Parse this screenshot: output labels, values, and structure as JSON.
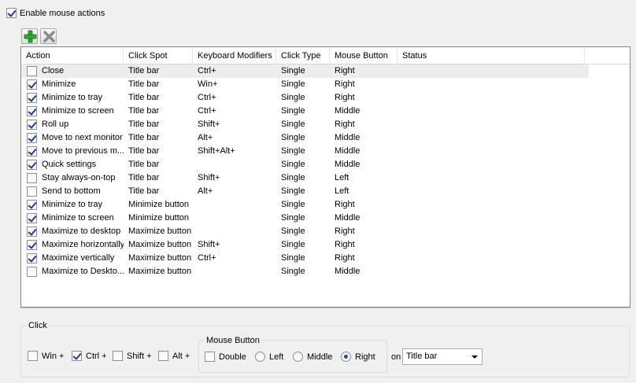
{
  "enable": {
    "label": "Enable mouse actions",
    "checked": true
  },
  "toolbar": {
    "add_icon": "green-plus-icon",
    "remove_icon": "gray-x-icon"
  },
  "grid": {
    "columns": [
      "Action",
      "Click Spot",
      "Keyboard Modifiers",
      "Click Type",
      "Mouse Button",
      "Status"
    ],
    "rows": [
      {
        "checked": false,
        "action": "Close",
        "spot": "Title bar",
        "mods": "Ctrl+",
        "type": "Single",
        "button": "Right",
        "status": "",
        "selected": true
      },
      {
        "checked": true,
        "action": "Minimize",
        "spot": "Title bar",
        "mods": "Win+",
        "type": "Single",
        "button": "Right",
        "status": ""
      },
      {
        "checked": true,
        "action": "Minimize to tray",
        "spot": "Title bar",
        "mods": "Ctrl+",
        "type": "Single",
        "button": "Right",
        "status": ""
      },
      {
        "checked": true,
        "action": "Minimize to screen",
        "spot": "Title bar",
        "mods": "Ctrl+",
        "type": "Single",
        "button": "Middle",
        "status": ""
      },
      {
        "checked": true,
        "action": "Roll up",
        "spot": "Title bar",
        "mods": "Shift+",
        "type": "Single",
        "button": "Right",
        "status": ""
      },
      {
        "checked": true,
        "action": "Move to next monitor",
        "spot": "Title bar",
        "mods": "Alt+",
        "type": "Single",
        "button": "Middle",
        "status": ""
      },
      {
        "checked": true,
        "action": "Move to previous m...",
        "spot": "Title bar",
        "mods": "Shift+Alt+",
        "type": "Single",
        "button": "Middle",
        "status": ""
      },
      {
        "checked": true,
        "action": "Quick settings",
        "spot": "Title bar",
        "mods": "",
        "type": "Single",
        "button": "Middle",
        "status": ""
      },
      {
        "checked": false,
        "action": "Stay always-on-top",
        "spot": "Title bar",
        "mods": "Shift+",
        "type": "Single",
        "button": "Left",
        "status": ""
      },
      {
        "checked": false,
        "action": "Send to bottom",
        "spot": "Title bar",
        "mods": "Alt+",
        "type": "Single",
        "button": "Left",
        "status": ""
      },
      {
        "checked": true,
        "action": "Minimize to tray",
        "spot": "Minimize button",
        "mods": "",
        "type": "Single",
        "button": "Right",
        "status": ""
      },
      {
        "checked": true,
        "action": "Minimize to screen",
        "spot": "Minimize button",
        "mods": "",
        "type": "Single",
        "button": "Middle",
        "status": ""
      },
      {
        "checked": true,
        "action": "Maximize to desktop",
        "spot": "Maximize button",
        "mods": "",
        "type": "Single",
        "button": "Right",
        "status": ""
      },
      {
        "checked": true,
        "action": "Maximize horizontally",
        "spot": "Maximize button",
        "mods": "Shift+",
        "type": "Single",
        "button": "Right",
        "status": ""
      },
      {
        "checked": true,
        "action": "Maximize vertically",
        "spot": "Maximize button",
        "mods": "Ctrl+",
        "type": "Single",
        "button": "Right",
        "status": ""
      },
      {
        "checked": false,
        "action": "Maximize to Deskto...",
        "spot": "Maximize button",
        "mods": "",
        "type": "Single",
        "button": "Middle",
        "status": ""
      }
    ]
  },
  "click": {
    "legend": "Click",
    "modifiers": [
      {
        "label": "Win +",
        "checked": false
      },
      {
        "label": "Ctrl +",
        "checked": true
      },
      {
        "label": "Shift +",
        "checked": false
      },
      {
        "label": "Alt +",
        "checked": false
      }
    ],
    "mouse_button": {
      "legend": "Mouse Button",
      "double_label": "Double",
      "double_checked": false,
      "options": [
        {
          "label": "Left",
          "selected": false
        },
        {
          "label": "Middle",
          "selected": false
        },
        {
          "label": "Right",
          "selected": true
        }
      ]
    },
    "on_label": "on",
    "spot_value": "Title bar"
  }
}
